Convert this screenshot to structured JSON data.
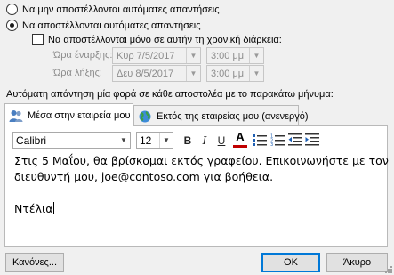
{
  "options": {
    "no_auto_reply": "Να μην αποστέλλονται αυτόματες απαντήσεις",
    "send_auto_reply": "Να αποστέλλονται αυτόματες απαντήσεις",
    "only_time_range": "Να αποστέλλονται μόνο σε αυτήν τη χρονική διάρκεια:",
    "selected": "send_auto_reply",
    "only_time_range_checked": false
  },
  "time_range": {
    "start_label": "Ώρα έναρξης:",
    "start_date": "Κυρ 7/5/2017",
    "start_time": "3:00 μμ",
    "end_label": "Ώρα λήξης:",
    "end_date": "Δευ 8/5/2017",
    "end_time": "3:00 μμ"
  },
  "instruction": "Αυτόματη απάντηση μία φορά σε κάθε αποστολέα με το παρακάτω μήνυμα:",
  "tabs": [
    {
      "label": "Μέσα στην εταιρεία μου",
      "active": true
    },
    {
      "label": "Εκτός της εταιρείας μου (ανενεργό)",
      "active": false
    }
  ],
  "format": {
    "font": "Calibri",
    "size": "12",
    "bold": "B",
    "italic": "I",
    "underline": "U",
    "font_color": "A"
  },
  "message": {
    "line1": "Στις 5 Μαΐου, θα βρίσκομαι εκτός γραφείου. Επικοινωνήστε με τον",
    "line2": "διευθυντή μου, joe@contoso.com για βοήθεια.",
    "line3": "",
    "signature": "Ντέλια"
  },
  "buttons": {
    "rules": "Κανόνες...",
    "ok": "OK",
    "cancel": "Άκυρο"
  },
  "colors": {
    "accent": "#0078d7",
    "font_color_bar": "#c00000"
  }
}
